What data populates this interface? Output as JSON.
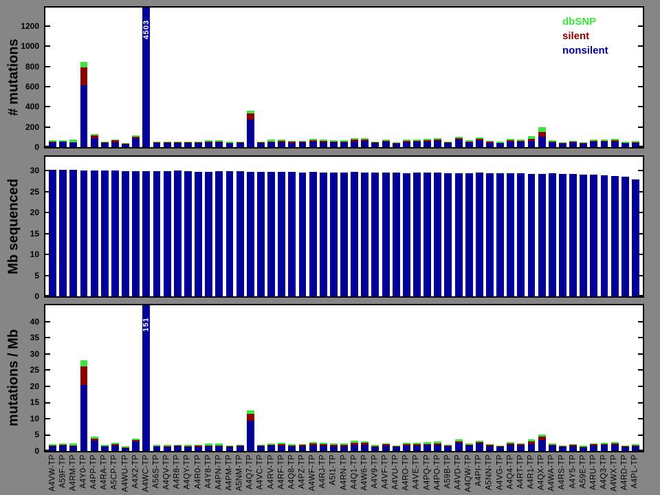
{
  "colors": {
    "background": "#868686",
    "frame": "#000000",
    "nonsilent": "#000099",
    "silent": "#8e0000",
    "dbsnp": "#39e639",
    "annotation_text": "#ffffff"
  },
  "legend": {
    "items": [
      {
        "label": "dbSNP",
        "color": "#39e639"
      },
      {
        "label": "silent",
        "color": "#8e0000"
      },
      {
        "label": "nonsilent",
        "color": "#000099"
      }
    ]
  },
  "categories": [
    "A4VW-TP",
    "A59F-TP",
    "A4RM-TP",
    "A4Y0-TP",
    "A4PP-TP",
    "A4RA-TP",
    "A5CP-TP",
    "A4WU-TP",
    "A4X2-TP",
    "A4WC-TP",
    "A56S-TP",
    "A4QV-TP",
    "A4R8-TP",
    "A4QY-TP",
    "A4R0-TP",
    "A4Y8-TP",
    "A4PN-TP",
    "A4PM-TP",
    "A5NM-TP",
    "A4Q7-TP",
    "A4VC-TP",
    "A4RV-TP",
    "A4RF-TP",
    "A4Q8-TP",
    "A4PZ-TP",
    "A4WF-TP",
    "A4RJ-TP",
    "A5I1-TP",
    "A4RN-TP",
    "A4Q1-TP",
    "A4W6-TP",
    "A4V9-TP",
    "A4VF-TP",
    "A4VU-TP",
    "A4RO-TP",
    "A4VE-TP",
    "A4PQ-TP",
    "A4PO-TP",
    "A59B-TP",
    "A4VD-TP",
    "A4QW-TP",
    "A4PI-TP",
    "A5NN-TP",
    "A4VG-TP",
    "A4Q4-TP",
    "A4RT-TP",
    "A4R1-TP",
    "A4QX-TP",
    "A4WA-TP",
    "A4RS-TP",
    "A4Y5-TP",
    "A59E-TP",
    "A4RU-TP",
    "A4Q3-TP",
    "A4WX-TP",
    "A4RD-TP",
    "A4PL-TP"
  ],
  "chart_data": [
    {
      "type": "bar",
      "stacked": true,
      "ylabel": "# mutations",
      "yticks": [
        0,
        200,
        400,
        600,
        800,
        1000,
        1200
      ],
      "ylim": [
        0,
        1385
      ],
      "grid": false,
      "legend_position": "top-right",
      "series": [
        {
          "name": "nonsilent",
          "values": [
            45,
            52,
            45,
            615,
            90,
            42,
            48,
            25,
            88,
            4300,
            42,
            40,
            44,
            40,
            40,
            46,
            46,
            38,
            42,
            270,
            44,
            48,
            50,
            44,
            46,
            52,
            50,
            46,
            46,
            58,
            60,
            40,
            52,
            36,
            50,
            52,
            55,
            60,
            42,
            72,
            48,
            66,
            44,
            38,
            56,
            52,
            60,
            100,
            50,
            36,
            46,
            34,
            52,
            54,
            56,
            38,
            42
          ]
        },
        {
          "name": "silent",
          "values": [
            8,
            6,
            6,
            175,
            25,
            5,
            17,
            8,
            17,
            140,
            5,
            6,
            6,
            6,
            7,
            6,
            7,
            6,
            7,
            65,
            6,
            10,
            10,
            9,
            8,
            16,
            12,
            8,
            9,
            14,
            15,
            6,
            8,
            6,
            12,
            10,
            10,
            12,
            7,
            14,
            8,
            14,
            12,
            6,
            12,
            9,
            25,
            52,
            8,
            6,
            8,
            6,
            9,
            10,
            10,
            6,
            8
          ]
        },
        {
          "name": "dbSNP",
          "values": [
            13,
            12,
            21,
            55,
            15,
            9,
            10,
            9,
            10,
            63,
            8,
            9,
            8,
            9,
            8,
            16,
            15,
            8,
            8,
            28,
            8,
            14,
            17,
            9,
            10,
            16,
            14,
            13,
            12,
            18,
            12,
            8,
            12,
            8,
            13,
            13,
            16,
            18,
            8,
            19,
            12,
            16,
            8,
            8,
            14,
            12,
            25,
            48,
            10,
            8,
            10,
            8,
            11,
            12,
            13,
            8,
            12
          ]
        }
      ],
      "offscale_label": {
        "category_index": 9,
        "text": "4503"
      }
    },
    {
      "type": "bar",
      "stacked": false,
      "ylabel": "Mb sequenced",
      "yticks": [
        0,
        5,
        10,
        15,
        20,
        25,
        30
      ],
      "ylim": [
        0,
        33.3
      ],
      "grid": false,
      "series": [
        {
          "name": "Mb sequenced",
          "values": [
            30.2,
            30.2,
            30.25,
            30.05,
            30.1,
            30.05,
            30.0,
            29.9,
            29.9,
            29.85,
            29.85,
            29.9,
            29.95,
            29.8,
            29.75,
            29.75,
            29.8,
            29.85,
            29.8,
            29.75,
            29.65,
            29.7,
            29.75,
            29.65,
            29.6,
            29.65,
            29.6,
            29.55,
            29.6,
            29.65,
            29.55,
            29.5,
            29.55,
            29.45,
            29.4,
            29.45,
            29.5,
            29.45,
            29.4,
            29.35,
            29.4,
            29.5,
            29.35,
            29.3,
            29.35,
            29.3,
            29.25,
            29.25,
            29.3,
            29.25,
            29.15,
            29.05,
            29.1,
            28.95,
            28.7,
            28.5,
            27.95
          ]
        }
      ]
    },
    {
      "type": "bar",
      "stacked": true,
      "ylabel": "mutations / Mb",
      "yticks": [
        0,
        5,
        10,
        15,
        20,
        25,
        30,
        35,
        40
      ],
      "ylim": [
        0,
        45.1
      ],
      "grid": false,
      "series": [
        {
          "name": "nonsilent",
          "values": [
            1.5,
            1.75,
            1.5,
            20.4,
            3.1,
            1.4,
            1.6,
            0.85,
            2.95,
            145,
            1.4,
            1.35,
            1.5,
            1.35,
            1.35,
            1.55,
            1.55,
            1.3,
            1.4,
            9.3,
            1.5,
            1.6,
            1.7,
            1.5,
            1.55,
            1.75,
            1.7,
            1.55,
            1.55,
            2.0,
            2.0,
            1.35,
            1.75,
            1.2,
            1.7,
            1.75,
            1.85,
            2.0,
            1.4,
            2.45,
            1.6,
            2.25,
            1.5,
            1.3,
            1.9,
            1.75,
            2.05,
            3.4,
            1.7,
            1.2,
            1.55,
            1.15,
            1.75,
            1.85,
            1.9,
            1.3,
            1.45
          ]
        },
        {
          "name": "silent",
          "values": [
            0.25,
            0.2,
            0.2,
            5.8,
            0.8,
            0.17,
            0.55,
            0.27,
            0.55,
            4.0,
            0.17,
            0.2,
            0.2,
            0.2,
            0.25,
            0.2,
            0.25,
            0.2,
            0.25,
            2.2,
            0.2,
            0.35,
            0.35,
            0.3,
            0.3,
            0.55,
            0.4,
            0.3,
            0.3,
            0.5,
            0.5,
            0.2,
            0.3,
            0.2,
            0.4,
            0.35,
            0.35,
            0.4,
            0.25,
            0.5,
            0.3,
            0.5,
            0.4,
            0.2,
            0.4,
            0.3,
            0.85,
            1.05,
            0.3,
            0.2,
            0.3,
            0.2,
            0.3,
            0.35,
            0.35,
            0.2,
            0.3
          ]
        },
        {
          "name": "dbSNP",
          "values": [
            0.45,
            0.4,
            0.7,
            1.9,
            0.5,
            0.3,
            0.35,
            0.3,
            0.35,
            2.0,
            0.3,
            0.3,
            0.3,
            0.3,
            0.3,
            0.55,
            0.5,
            0.3,
            0.3,
            1.0,
            0.3,
            0.45,
            0.55,
            0.3,
            0.35,
            0.55,
            0.45,
            0.45,
            0.4,
            0.6,
            0.4,
            0.3,
            0.4,
            0.3,
            0.45,
            0.45,
            0.55,
            0.6,
            0.3,
            0.65,
            0.4,
            0.55,
            0.3,
            0.3,
            0.5,
            0.4,
            0.8,
            0.75,
            0.35,
            0.3,
            0.35,
            0.3,
            0.4,
            0.4,
            0.45,
            0.3,
            0.4
          ]
        }
      ],
      "offscale_label": {
        "category_index": 9,
        "text": "151"
      }
    }
  ]
}
